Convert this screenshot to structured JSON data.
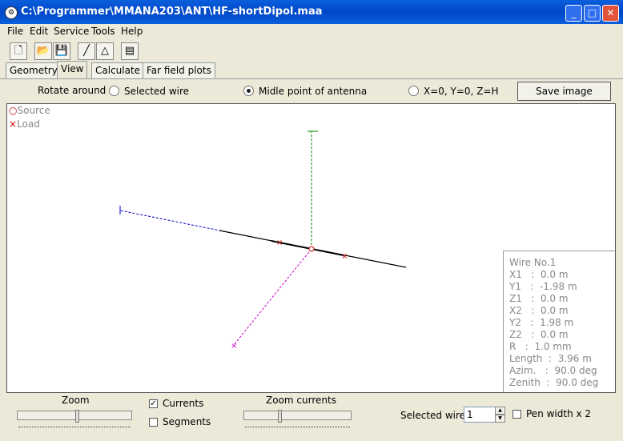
{
  "window": {
    "title": "C:\\Programmer\\MMANA203\\ANT\\HF-shortDipol.maa"
  },
  "menu": {
    "items": [
      "File",
      "Edit",
      "Service",
      "Tools",
      "Help"
    ]
  },
  "tabs": {
    "items": [
      "Geometry",
      "View",
      "Calculate",
      "Far field plots"
    ],
    "active": "View"
  },
  "view": {
    "rotate_label": "Rotate around :",
    "options": [
      {
        "label": "Selected wire",
        "checked": false
      },
      {
        "label": "Midle point of antenna",
        "checked": true
      },
      {
        "label": "X=0, Y=0, Z=H",
        "checked": false
      }
    ],
    "save_button": "Save image"
  },
  "legend": {
    "source": "Source",
    "load": "Load"
  },
  "wire_info": {
    "lines": [
      "Wire No.1",
      "X1   :  0.0 m",
      "Y1   :  -1.98 m",
      "Z1   :  0.0 m",
      "X2   :  0.0 m",
      "Y2   :  1.98 m",
      "Z2   :  0.0 m",
      "R   :  1.0 mm",
      "Length  :  3.96 m",
      "Azim.   :  90.0 deg",
      "Zenith  :  90.0 deg"
    ]
  },
  "bottom": {
    "zoom_label": "Zoom",
    "currents_label": "Currents",
    "currents_checked": true,
    "segments_label": "Segments",
    "segments_checked": false,
    "zoom_currents_label": "Zoom currents",
    "selected_wire_label": "Selected wire",
    "selected_wire_value": "1",
    "pen_width_label": "Pen width x 2",
    "pen_width_checked": false
  },
  "colors": {
    "titlebar": "#0a5fdd",
    "wire": "#000000",
    "x_axis": "#cc00cc",
    "y_axis": "#0000cc",
    "z_axis": "#008800",
    "load_marker": "#cc0000"
  }
}
